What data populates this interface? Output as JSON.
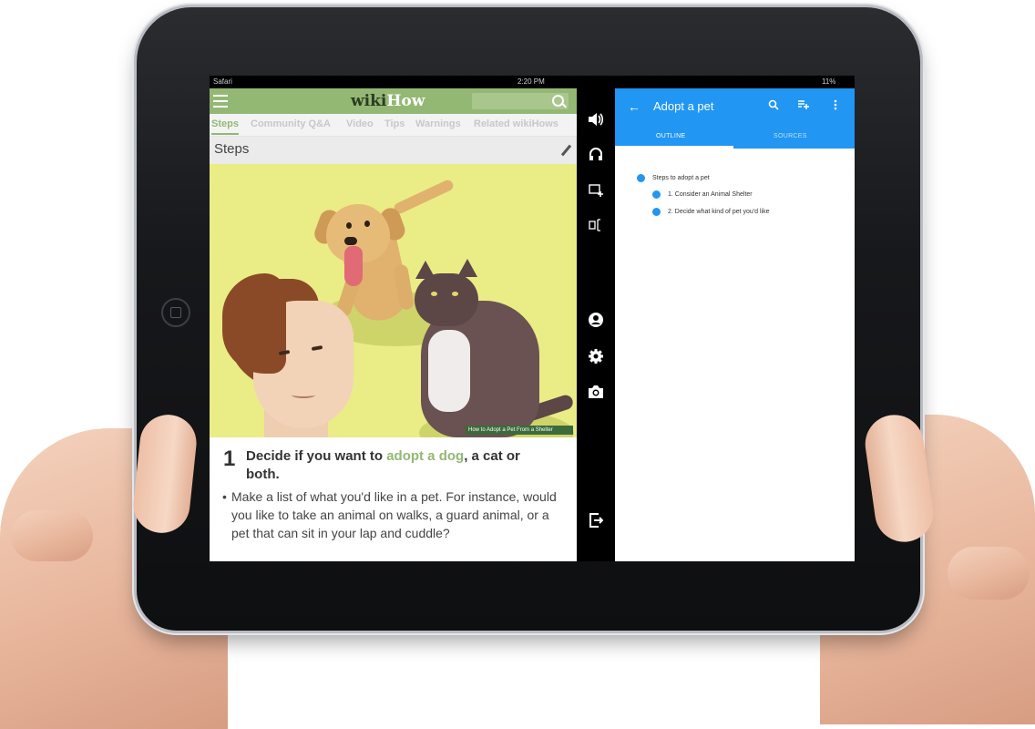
{
  "status_bar": {
    "carrier": "Safari",
    "time": "2:20 PM",
    "battery": "11%"
  },
  "wikihow": {
    "logo_wiki": "wiki",
    "logo_how": "How",
    "tabs": [
      "Steps",
      "Community Q&A",
      "Video",
      "Tips",
      "Warnings",
      "Related wikiHows"
    ],
    "active_tab": "Steps",
    "section_title": "Steps",
    "watermark": "How to Adopt a Pet From a Shelter",
    "step": {
      "number": "1",
      "heading_before": "Decide if you want to ",
      "heading_link": "adopt a dog",
      "heading_after": ", a cat or both.",
      "bullet": "Make a list of what you'd like in a pet. For instance, would you like to take an animal on walks, a guard animal, or a pet that can sit in your lap and cuddle?"
    }
  },
  "sidebar": {
    "icons": [
      "volume-icon",
      "headphones-icon",
      "screen-add-icon",
      "layout-icon",
      "account-icon",
      "settings-icon",
      "camera-icon",
      "exit-icon"
    ]
  },
  "outline_app": {
    "title": "Adopt a pet",
    "tabs": [
      "OUTLINE",
      "SOURCES"
    ],
    "active_tab": "OUTLINE",
    "accent": "#2196f3",
    "items": [
      {
        "text": "Steps to adopt a pet"
      },
      {
        "text": "1. Consider an Animal Shelter"
      },
      {
        "text": "2. Decide what kind of pet you'd like"
      }
    ]
  }
}
